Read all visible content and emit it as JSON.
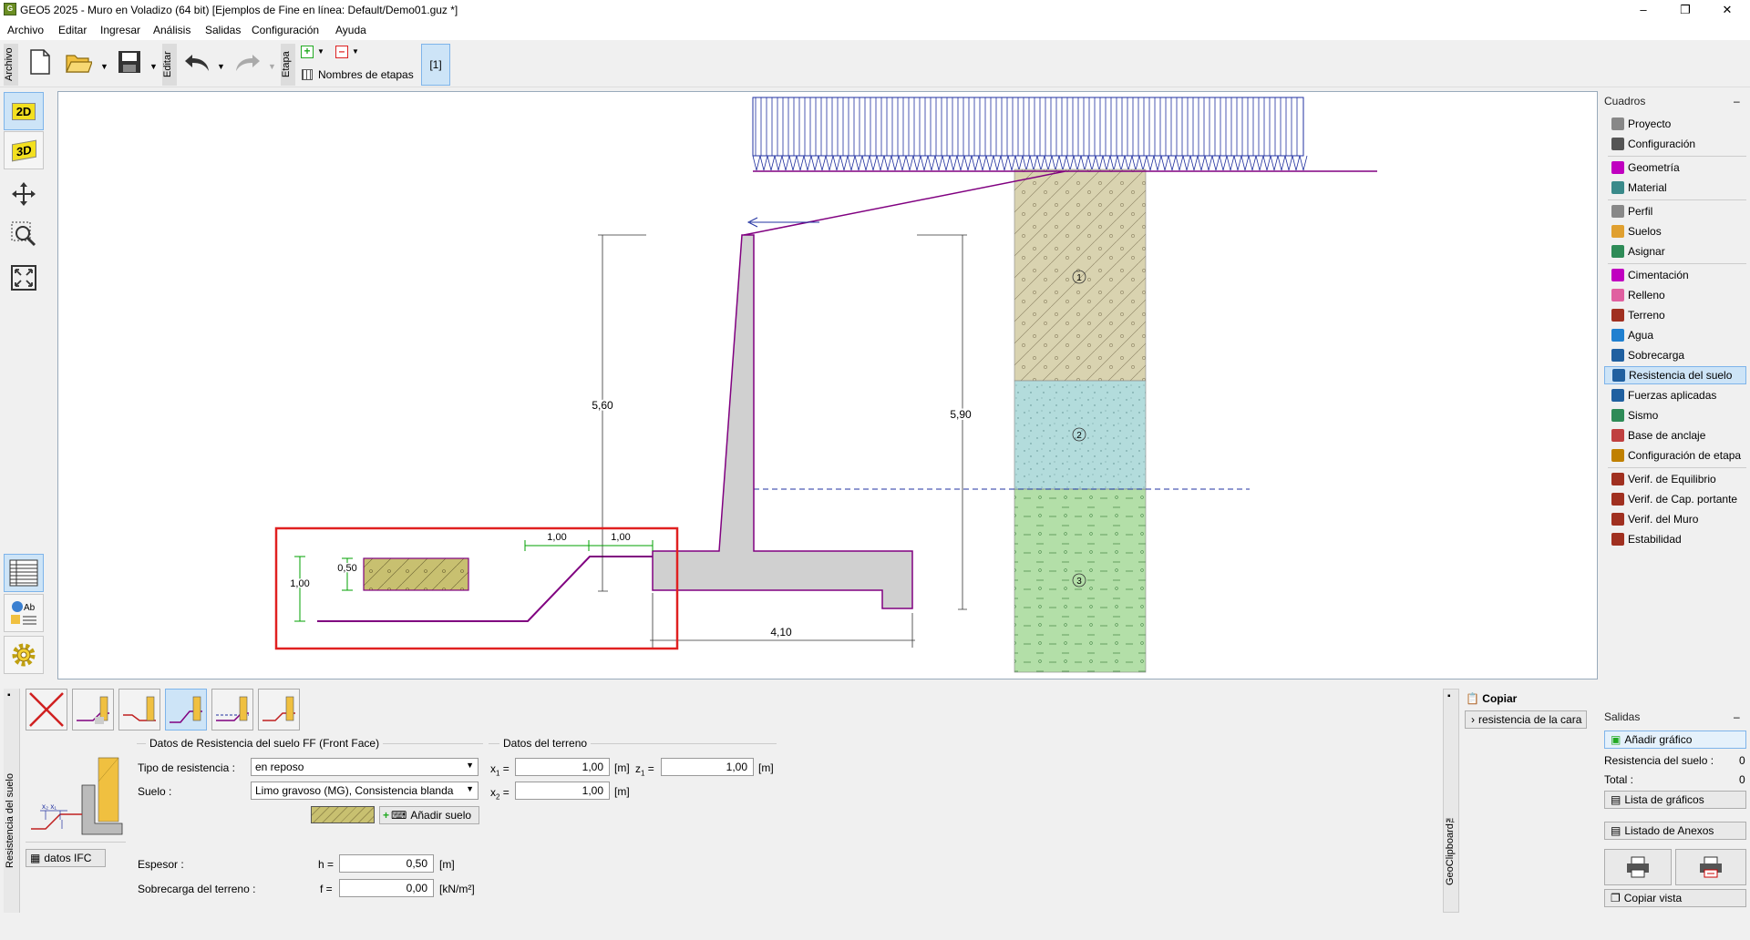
{
  "window": {
    "title": "GEO5 2025 - Muro en Voladizo (64 bit) [Ejemplos de Fine en línea: Default/Demo01.guz *]",
    "minimize": "–",
    "restore": "❐",
    "close": "✕"
  },
  "menu": [
    "Archivo",
    "Editar",
    "Ingresar",
    "Análisis",
    "Salidas",
    "Configuración",
    "Ayuda"
  ],
  "toolbar": {
    "archivo_tab": "Archivo",
    "editar_tab": "Editar",
    "etapa_tab": "Etapa",
    "stage_names_label": "Nombres de etapas",
    "stage_current": "[1]"
  },
  "left_tools": {
    "view2d": "2D",
    "view3d": "3D"
  },
  "drawing": {
    "dim_wall_height": "5,60",
    "dim_total_height": "5,90",
    "dim_base_width": "4,10",
    "dim_x1": "1,00",
    "dim_x2": "1,00",
    "dim_resist_height": "1,00",
    "dim_resist_thickness": "0,50",
    "layer_1": "1",
    "layer_2": "2",
    "layer_3": "3",
    "colors": {
      "wall": "#d0d0d0",
      "terrain": "#800080",
      "layer1": "#d9d3b0",
      "layer2": "#b3dcdc",
      "layer3": "#b3dfa8",
      "highlight": "#e02020",
      "dimension": "#00a000"
    }
  },
  "right_panel": {
    "header": "Cuadros",
    "items": [
      {
        "label": "Proyecto",
        "icon": "document-icon",
        "color": "#888"
      },
      {
        "label": "Configuración",
        "icon": "gear-icon",
        "color": "#555"
      },
      {
        "label": "Geometría",
        "icon": "geometry-icon",
        "color": "#c000c0"
      },
      {
        "label": "Material",
        "icon": "material-icon",
        "color": "#3a8a8a"
      },
      {
        "label": "Perfil",
        "icon": "profile-icon",
        "color": "#888"
      },
      {
        "label": "Suelos",
        "icon": "soils-icon",
        "color": "#e0a030"
      },
      {
        "label": "Asignar",
        "icon": "assign-icon",
        "color": "#2e8b57"
      },
      {
        "label": "Cimentación",
        "icon": "foundation-icon",
        "color": "#c000c0"
      },
      {
        "label": "Relleno",
        "icon": "backfill-icon",
        "color": "#e060a0"
      },
      {
        "label": "Terreno",
        "icon": "terrain-icon",
        "color": "#a03020"
      },
      {
        "label": "Agua",
        "icon": "water-icon",
        "color": "#2080d0"
      },
      {
        "label": "Sobrecarga",
        "icon": "surcharge-icon",
        "color": "#2060a0"
      },
      {
        "label": "Resistencia del suelo",
        "icon": "resistance-icon",
        "color": "#2060a0"
      },
      {
        "label": "Fuerzas aplicadas",
        "icon": "forces-icon",
        "color": "#2060a0"
      },
      {
        "label": "Sismo",
        "icon": "earthquake-icon",
        "color": "#2e8b57"
      },
      {
        "label": "Base de anclaje",
        "icon": "anchor-base-icon",
        "color": "#c04040"
      },
      {
        "label": "Configuración de etapa",
        "icon": "stage-settings-icon",
        "color": "#c08000"
      },
      {
        "label": "Verif. de Equilibrio",
        "icon": "equilibrium-icon",
        "color": "#a03020"
      },
      {
        "label": "Verif. de Cap. portante",
        "icon": "bearing-icon",
        "color": "#a03020"
      },
      {
        "label": "Verif. del Muro",
        "icon": "wall-check-icon",
        "color": "#a03020"
      },
      {
        "label": "Estabilidad",
        "icon": "stability-icon",
        "color": "#a03020"
      }
    ],
    "selected_index": 12
  },
  "outputs": {
    "header": "Salidas",
    "add_graphic": "Añadir gráfico",
    "soil_resistance_label": "Resistencia del suelo :",
    "soil_resistance_count": "0",
    "total_label": "Total :",
    "total_count": "0",
    "graphics_list": "Lista de gráficos",
    "annex_list": "Listado de Anexos",
    "copy_view": "Copiar vista"
  },
  "bottom": {
    "vertical_label": "Resistencia del suelo",
    "section_title": "Datos de Resistencia del suelo FF (Front Face)",
    "terrain_title": "Datos del terreno",
    "resistance_type_label": "Tipo de resistencia :",
    "resistance_type_value": "en reposo",
    "soil_label": "Suelo :",
    "soil_value": "Limo gravoso (MG), Consistencia blanda",
    "add_soil": "Añadir suelo",
    "ifc_button": "datos IFC",
    "x1_label": "x",
    "x1_sub": "1",
    "x1_value": "1,00",
    "z1_label": "z",
    "z1_sub": "1",
    "z1_value": "1,00",
    "x2_label": "x",
    "x2_sub": "2",
    "x2_value": "1,00",
    "unit_m": "[m]",
    "eq": "=",
    "thickness_label": "Espesor :",
    "thickness_sym": "h =",
    "thickness_value": "0,50",
    "surcharge_label": "Sobrecarga del terreno :",
    "surcharge_sym": "f =",
    "surcharge_value": "0,00",
    "unit_kn": "[kN/m²]"
  },
  "geoclipboard": {
    "label": "GeoClipboard™",
    "copy": "Copiar",
    "front_face": "resistencia de la cara"
  }
}
